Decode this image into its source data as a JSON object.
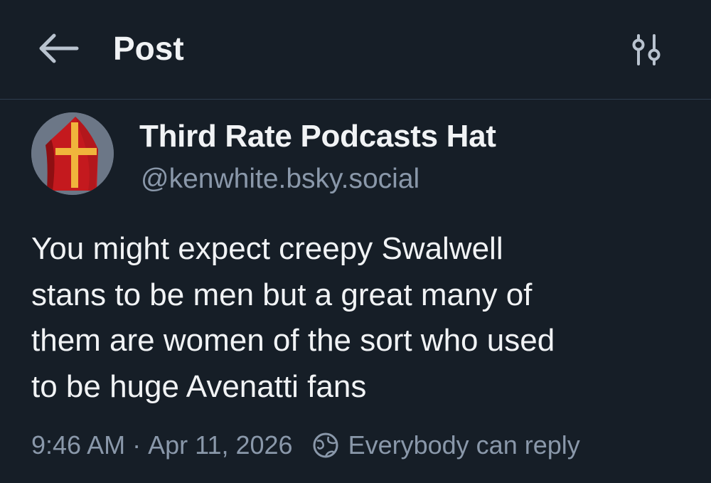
{
  "header": {
    "back_icon": "arrow-left-icon",
    "title": "Post",
    "settings_icon": "sliders-icon"
  },
  "author": {
    "avatar_icon": "bishop-mitre-avatar",
    "display_name": "Third Rate Podcasts Hat",
    "handle": "@kenwhite.bsky.social"
  },
  "post": {
    "lines": [
      "You might expect creepy Swalwell",
      "stans to be men but a great many of",
      "them are women of the sort who used",
      "to be huge Avenatti fans"
    ]
  },
  "meta": {
    "time": "9:46 AM",
    "separator": "·",
    "date": "Apr 11, 2026",
    "reply_icon": "globe-icon",
    "reply_setting": "Everybody can reply"
  },
  "colors": {
    "background": "#161e27",
    "text_primary": "#f1f3f5",
    "text_secondary": "#8a98aa",
    "divider": "#2e3d4f",
    "mitre_red": "#c4191e",
    "cross_gold": "#f0b43c"
  }
}
